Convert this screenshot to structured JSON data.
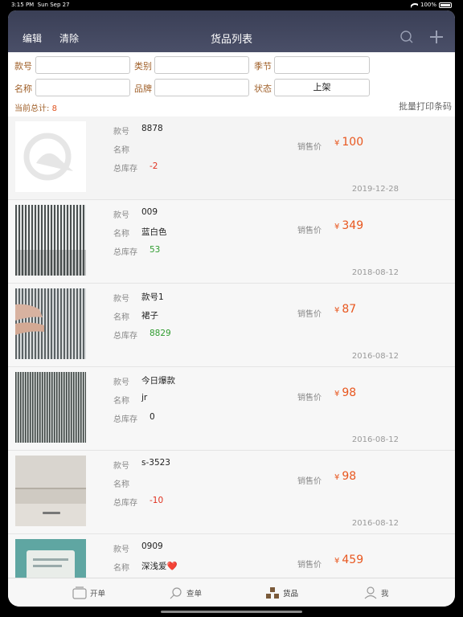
{
  "status": {
    "time": "3:15 PM",
    "date": "Sun Sep 27",
    "battery": "100%"
  },
  "nav": {
    "edit": "编辑",
    "clear": "清除",
    "title": "货品列表"
  },
  "filters": {
    "style_no": {
      "label": "款号",
      "value": ""
    },
    "category": {
      "label": "类别",
      "value": ""
    },
    "season": {
      "label": "季节",
      "value": ""
    },
    "name": {
      "label": "名称",
      "value": ""
    },
    "brand": {
      "label": "品牌",
      "value": ""
    },
    "state": {
      "label": "状态",
      "value": "上架"
    }
  },
  "summary": {
    "label": "当前总计:",
    "count": "8",
    "batch_print": "批量打印条码"
  },
  "labels": {
    "style_no": "款号",
    "name": "名称",
    "stock": "总库存",
    "price": "销售价",
    "currency": "¥"
  },
  "items": [
    {
      "style_no": "8878",
      "name": "",
      "stock": "-2",
      "stock_color": "#e0311f",
      "price": "100",
      "date": "2019-12-28"
    },
    {
      "style_no": "009",
      "name": "蓝白色",
      "stock": "53",
      "stock_color": "#2f9c2f",
      "price": "349",
      "date": "2018-08-12"
    },
    {
      "style_no": "款号1",
      "name": "裙子",
      "stock": "8829",
      "stock_color": "#2f9c2f",
      "price": "87",
      "date": "2016-08-12"
    },
    {
      "style_no": "今日爆款",
      "name": "jr",
      "stock": "0",
      "stock_color": "#222222",
      "price": "98",
      "date": "2016-08-12"
    },
    {
      "style_no": "s-3523",
      "name": "",
      "stock": "-10",
      "stock_color": "#e0311f",
      "price": "98",
      "date": "2016-08-12"
    },
    {
      "style_no": "0909",
      "name": "深浅爱❤️",
      "stock": "",
      "stock_color": "#222222",
      "price": "459",
      "date": ""
    }
  ],
  "tabs": [
    {
      "label": "开单",
      "icon": "order-icon"
    },
    {
      "label": "查单",
      "icon": "search-order-icon"
    },
    {
      "label": "货品",
      "icon": "goods-icon",
      "active": true
    },
    {
      "label": "我",
      "icon": "user-icon"
    }
  ],
  "colors": {
    "nav_bg": "#434861",
    "accent_label": "#a0602a",
    "price": "#e8571f"
  }
}
